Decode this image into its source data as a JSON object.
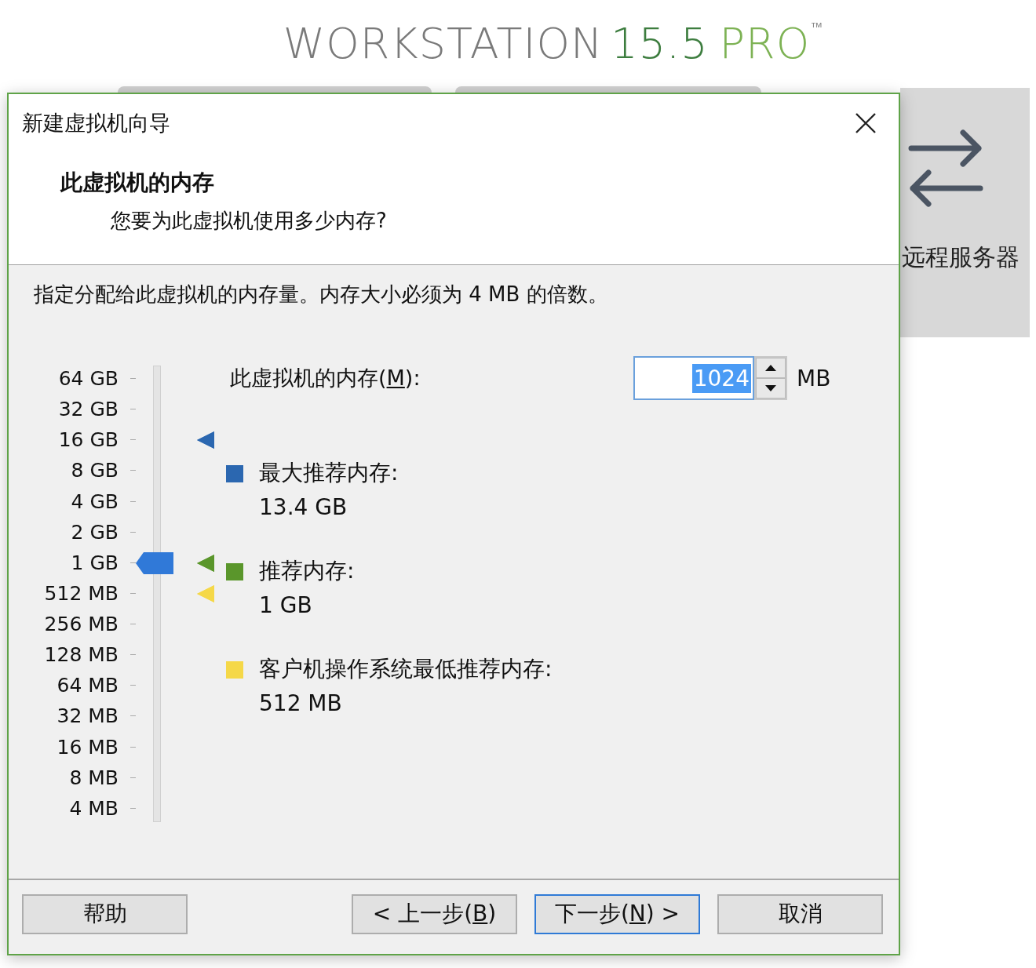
{
  "banner": {
    "product": "WORKSTATION",
    "version": "15.5",
    "edition": "PRO",
    "mark": "™"
  },
  "side_panel": {
    "label": "远程服务器"
  },
  "dialog": {
    "title": "新建虚拟机向导",
    "heading": "此虚拟机的内存",
    "subheading": "您要为此虚拟机使用多少内存?",
    "description": "指定分配给此虚拟机的内存量。内存大小必须为 4 MB 的倍数。",
    "slider": {
      "level": 0.571,
      "markers": [
        {
          "color": "#2b67b0",
          "level": 0.857
        },
        {
          "color": "#5a962b",
          "level": 0.571
        },
        {
          "color": "#f5d848",
          "level": 0.5
        }
      ],
      "ticks": [
        "64 GB",
        "32 GB",
        "16 GB",
        "8 GB",
        "4 GB",
        "2 GB",
        "1 GB",
        "512 MB",
        "256 MB",
        "128 MB",
        "64 MB",
        "32 MB",
        "16 MB",
        "8 MB",
        "4 MB"
      ]
    },
    "memory_field": {
      "label_before": "此虚拟机的内存(",
      "accesskey": "M",
      "label_after": "):",
      "value": "1024",
      "value_selected": true,
      "unit": "MB"
    },
    "legend": [
      {
        "label": "最大推荐内存:",
        "value": "13.4 GB",
        "color": "#2b67b0"
      },
      {
        "label": "推荐内存:",
        "value": "1 GB",
        "color": "#5a962b"
      },
      {
        "label": "客户机操作系统最低推荐内存:",
        "value": "512 MB",
        "color": "#f5d848"
      }
    ],
    "buttons": [
      {
        "before": "帮助",
        "focused": false
      },
      {
        "before": "< 上一步(",
        "accesskey": "B",
        "after": ")",
        "focused": false
      },
      {
        "before": "下一步(",
        "accesskey": "N",
        "after": ") >",
        "focused": true
      },
      {
        "before": "取消",
        "focused": false
      }
    ]
  }
}
